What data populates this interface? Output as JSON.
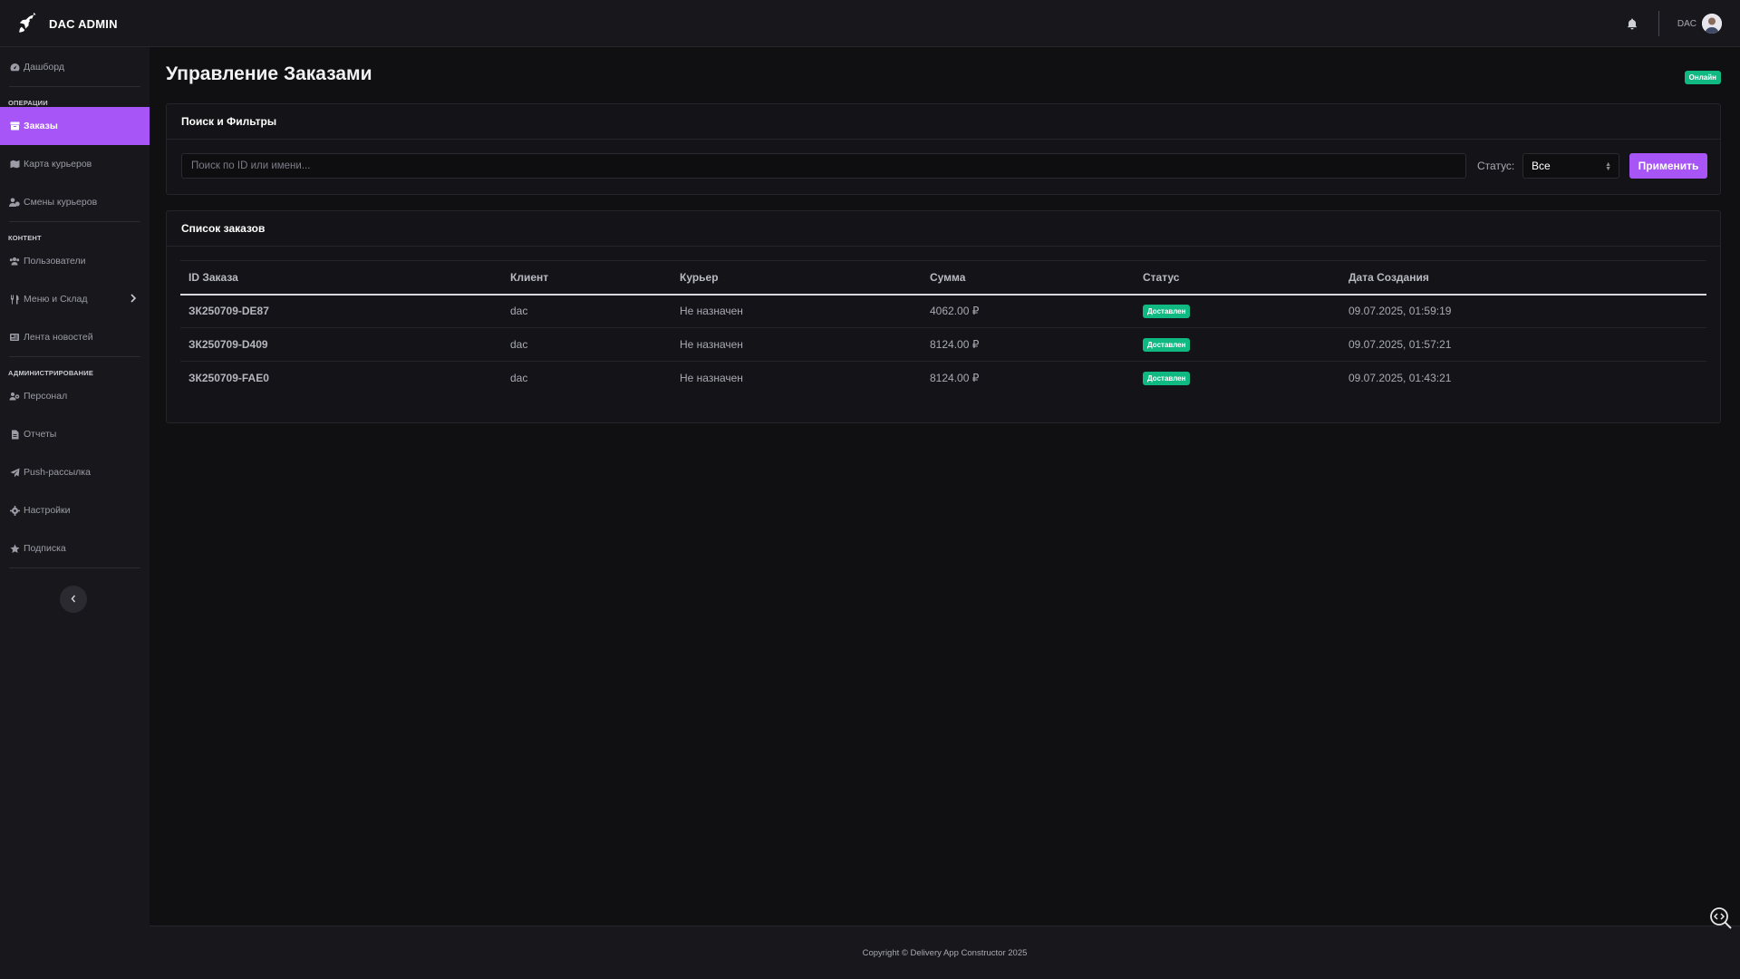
{
  "brand": {
    "name": "DAC ADMIN",
    "icon": "rocket-icon"
  },
  "topbar": {
    "user_name": "DAC",
    "bell_icon": "bell-icon"
  },
  "sidebar": {
    "items": [
      {
        "label": "Дашборд",
        "icon": "tachometer-icon"
      },
      {
        "label": "Заказы",
        "icon": "box-icon",
        "active": true
      },
      {
        "label": "Карта курьеров",
        "icon": "map-icon"
      },
      {
        "label": "Смены курьеров",
        "icon": "user-clock-icon"
      },
      {
        "label": "Пользователи",
        "icon": "users-icon"
      },
      {
        "label": "Меню и Склад",
        "icon": "utensils-icon",
        "has_chevron": true
      },
      {
        "label": "Лента новостей",
        "icon": "newspaper-icon"
      },
      {
        "label": "Персонал",
        "icon": "users-cog-icon"
      },
      {
        "label": "Отчеты",
        "icon": "file-icon"
      },
      {
        "label": "Push-рассылка",
        "icon": "paper-plane-icon"
      },
      {
        "label": "Настройки",
        "icon": "gear-icon"
      },
      {
        "label": "Подписка",
        "icon": "star-icon"
      }
    ],
    "sections": [
      "ОПЕРАЦИИ",
      "КОНТЕНТ",
      "АДМИНИСТРИРОВАНИЕ"
    ]
  },
  "main": {
    "title": "Управление Заказами",
    "status_badge": "Онлайн",
    "filters": {
      "header": "Поиск и Фильтры",
      "search_placeholder": "Поиск по ID или имени...",
      "status_label": "Статус:",
      "status_value": "Все",
      "apply_label": "Применить"
    },
    "orders": {
      "header": "Список заказов",
      "columns": [
        "ID Заказа",
        "Клиент",
        "Курьер",
        "Сумма",
        "Статус",
        "Дата Создания"
      ],
      "rows": [
        {
          "id": "ЗК250709-DE87",
          "client": "dac",
          "courier": "Не назначен",
          "amount": "4062.00 ₽",
          "status": "Доставлен",
          "date": "09.07.2025, 01:59:19"
        },
        {
          "id": "ЗК250709-D409",
          "client": "dac",
          "courier": "Не назначен",
          "amount": "8124.00 ₽",
          "status": "Доставлен",
          "date": "09.07.2025, 01:57:21"
        },
        {
          "id": "ЗК250709-FAE0",
          "client": "dac",
          "courier": "Не назначен",
          "amount": "8124.00 ₽",
          "status": "Доставлен",
          "date": "09.07.2025, 01:43:21"
        }
      ]
    }
  },
  "footer": {
    "text": "Copyright © Delivery App Constructor 2025"
  },
  "colors": {
    "accent": "#a855f7",
    "success": "#10b981",
    "background": "#101013",
    "panel": "#18181c"
  }
}
